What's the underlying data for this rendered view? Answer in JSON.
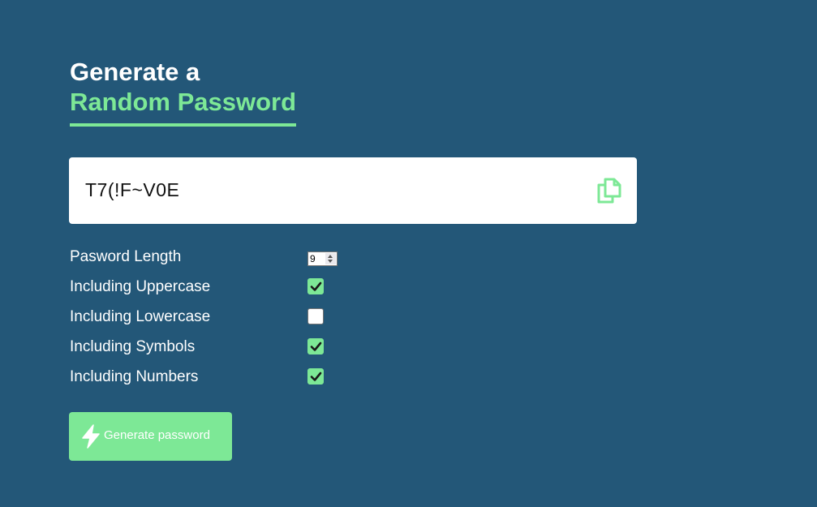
{
  "theme": {
    "background": "#235778",
    "accent": "#7de896"
  },
  "heading": {
    "line1": "Generate a",
    "line2": "Random Password"
  },
  "output": {
    "password": "T7(!F~V0E",
    "copy_icon": "copy-icon"
  },
  "options": {
    "length_label": "Pasword Length",
    "length_value": "9",
    "uppercase_label": "Including Uppercase",
    "uppercase_checked": true,
    "lowercase_label": "Including Lowercase",
    "lowercase_checked": false,
    "symbols_label": "Including Symbols",
    "symbols_checked": true,
    "numbers_label": "Including Numbers",
    "numbers_checked": true
  },
  "generate_button": {
    "label": "Generate password",
    "icon": "bolt-icon"
  }
}
